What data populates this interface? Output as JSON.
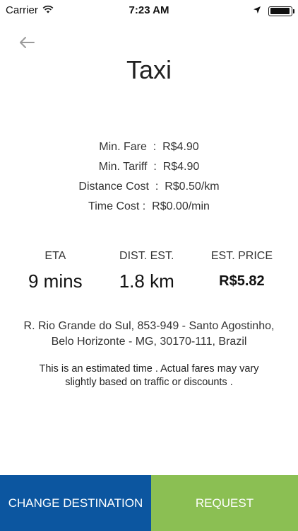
{
  "status_bar": {
    "carrier": "Carrier",
    "time": "7:23 AM",
    "battery_level": 0.95
  },
  "header": {
    "title": "Taxi"
  },
  "fares": [
    {
      "text": "Min. Fare  :  R$4.90"
    },
    {
      "text": "Min. Tariff  :  R$4.90"
    },
    {
      "text": "Distance Cost  :  R$0.50/km"
    },
    {
      "text": "Time Cost :  R$0.00/min"
    }
  ],
  "estimates": {
    "eta": {
      "label": "ETA",
      "value": "9 mins"
    },
    "distance": {
      "label": "DIST. EST.",
      "value": "1.8 km"
    },
    "price": {
      "label": "EST. PRICE",
      "value": "R$5.82"
    }
  },
  "address": {
    "line1": "R. Rio Grande do Sul, 853-949 - Santo Agostinho,",
    "line2": "Belo Horizonte - MG, 30170-111, Brazil"
  },
  "disclaimer": "This is an estimated time . Actual fares may vary slightly based on traffic or discounts .",
  "actions": {
    "change_destination": "CHANGE DESTINATION",
    "request": "REQUEST"
  },
  "colors": {
    "change_destination_bg": "#0c56a0",
    "request_bg": "#8bbf53"
  }
}
